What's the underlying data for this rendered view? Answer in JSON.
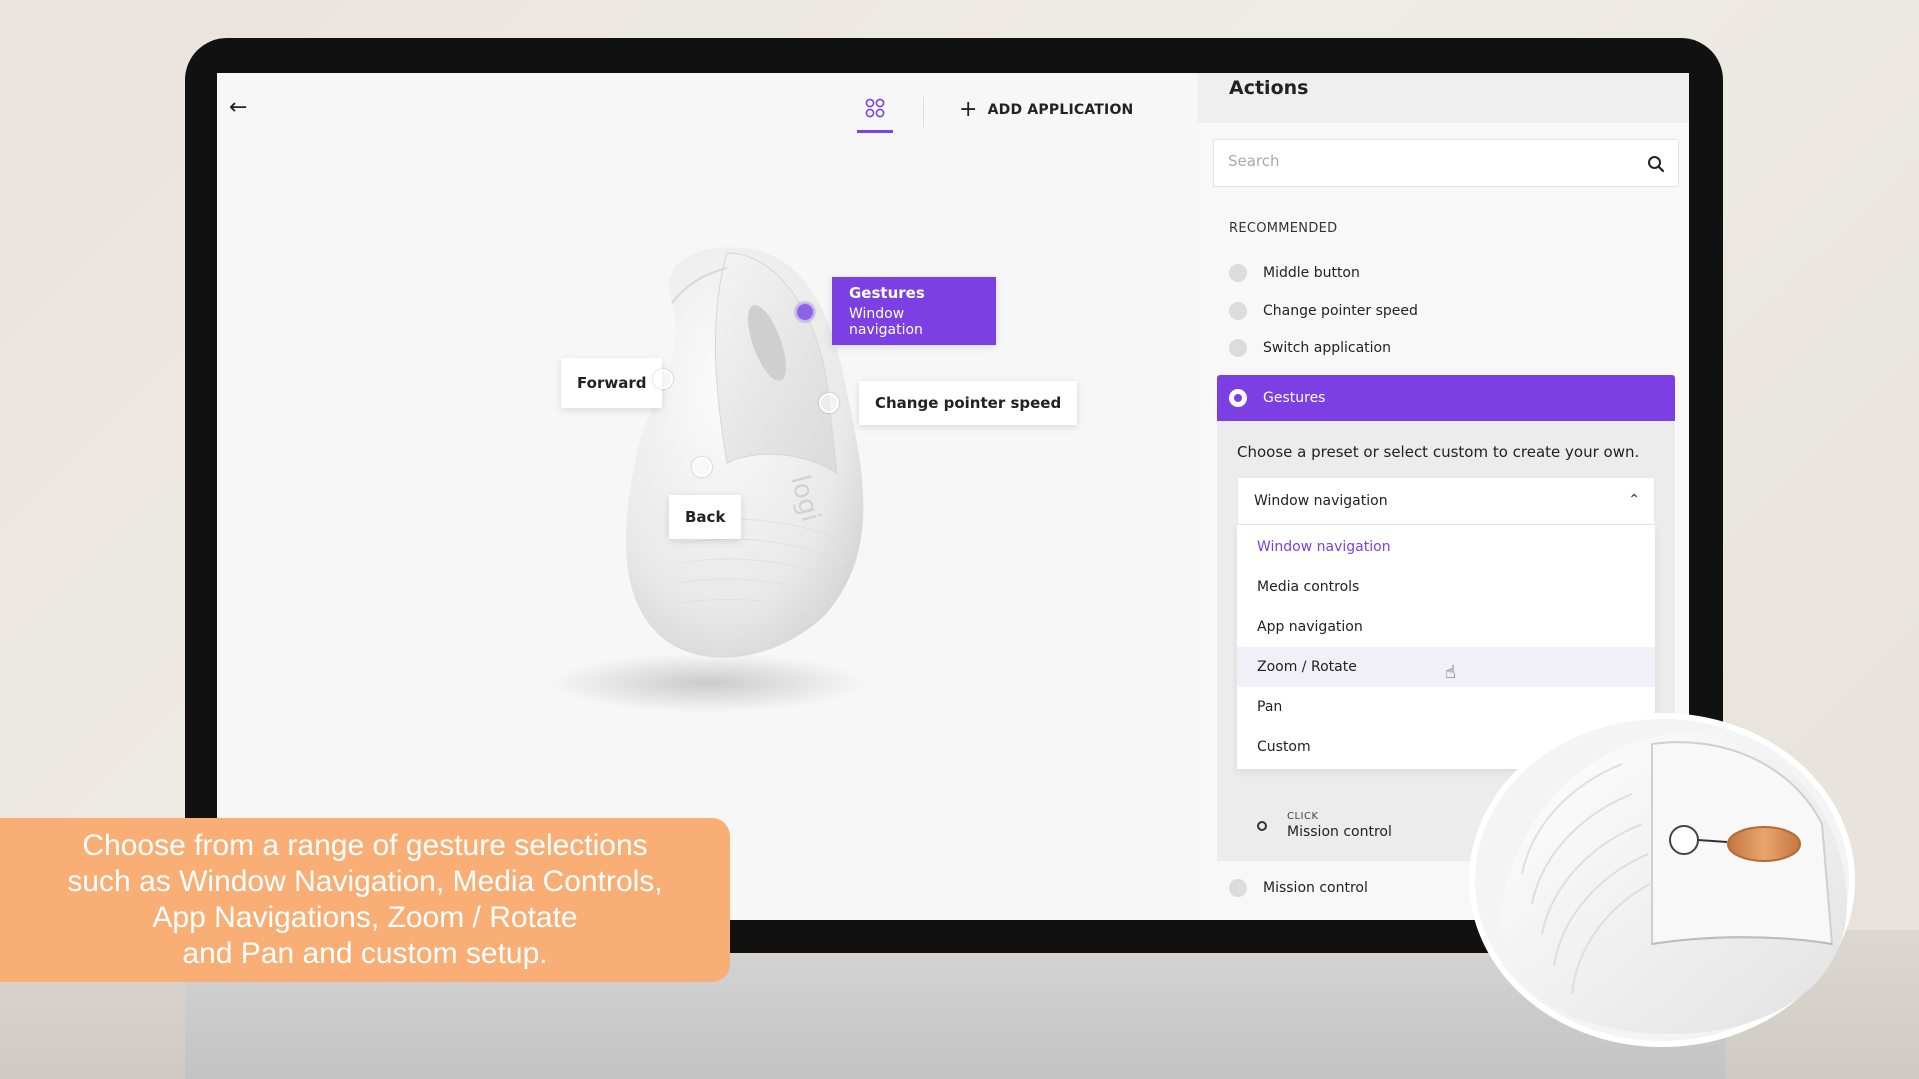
{
  "topbar": {
    "back_label": "←",
    "add_application_label": "ADD APPLICATION"
  },
  "mouse": {
    "brand": "logi",
    "callouts": {
      "forward": "Forward",
      "change_pointer_speed": "Change pointer speed",
      "back": "Back",
      "gestures_title": "Gestures",
      "gestures_subtitle": "Window navigation"
    }
  },
  "actions": {
    "title": "Actions",
    "search_placeholder": "Search",
    "recommended_label": "RECOMMENDED",
    "recommended": [
      "Middle button",
      "Change pointer speed",
      "Switch application"
    ],
    "selected_action": "Gestures",
    "gesture_description": "Choose a preset or select custom to create your own.",
    "preset_selected": "Window navigation",
    "preset_options": [
      "Window navigation",
      "Media controls",
      "App navigation",
      "Zoom / Rotate",
      "Pan",
      "Custom"
    ],
    "click_label": "CLICK",
    "click_value": "Mission control",
    "bottom_item": "Mission control"
  },
  "caption": {
    "lines": [
      "Choose from a range of gesture selections",
      "such as Window Navigation, Media Controls,",
      "App Navigations, Zoom / Rotate",
      "and Pan and custom setup."
    ]
  },
  "colors": {
    "accent": "#7b3fe4",
    "caption_bg": "#f8ae75",
    "bezel": "#111111"
  }
}
